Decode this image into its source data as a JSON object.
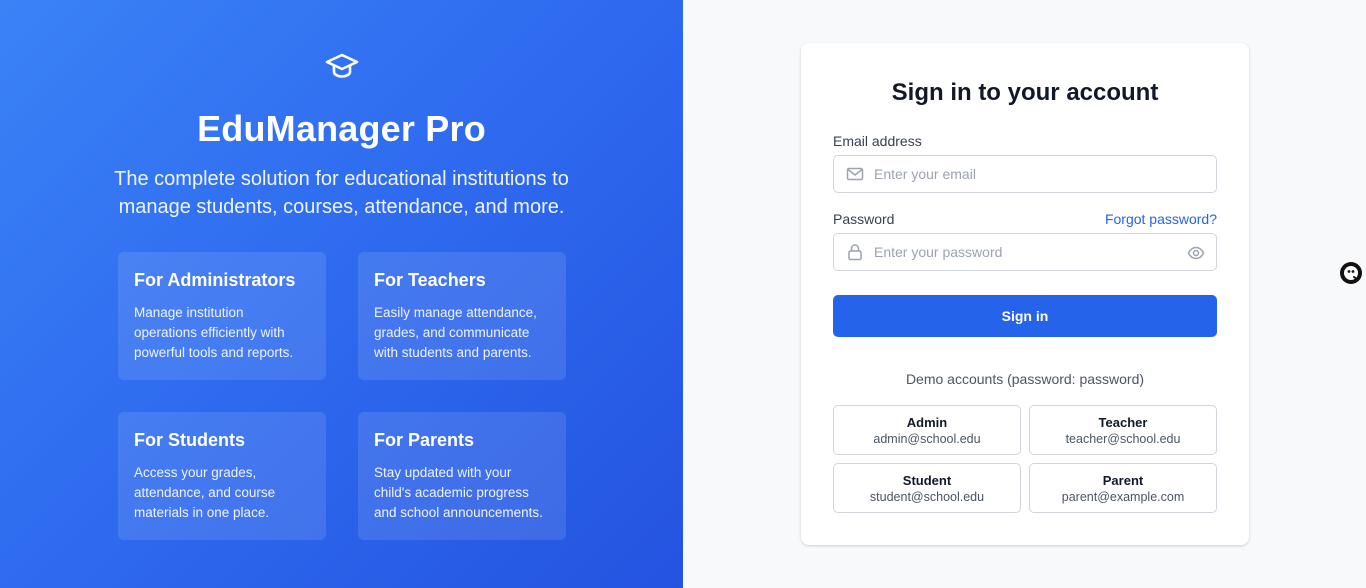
{
  "hero": {
    "title": "EduManager Pro",
    "subtitle": "The complete solution for educational institutions to manage students, courses, attendance, and more.",
    "icon": "graduation-cap-icon",
    "features": [
      {
        "title": "For Administrators",
        "text": "Manage institution operations efficiently with powerful tools and reports."
      },
      {
        "title": "For Teachers",
        "text": "Easily manage attendance, grades, and communicate with students and parents."
      },
      {
        "title": "For Students",
        "text": "Access your grades, attendance, and course materials in one place."
      },
      {
        "title": "For Parents",
        "text": "Stay updated with your child's academic progress and school announcements."
      }
    ]
  },
  "login": {
    "title": "Sign in to your account",
    "email_label": "Email address",
    "email_placeholder": "Enter your email",
    "email_value": "",
    "password_label": "Password",
    "forgot_label": "Forgot password?",
    "password_placeholder": "Enter your password",
    "password_value": "",
    "submit_label": "Sign in",
    "demo_title": "Demo accounts (password: password)",
    "demo_accounts": [
      {
        "role": "Admin",
        "email": "admin@school.edu"
      },
      {
        "role": "Teacher",
        "email": "teacher@school.edu"
      },
      {
        "role": "Student",
        "email": "student@school.edu"
      },
      {
        "role": "Parent",
        "email": "parent@example.com"
      }
    ]
  },
  "colors": {
    "brand": "#2563eb",
    "hero_start": "#3b82f6",
    "hero_end": "#2453e0",
    "right_bg": "#f8f9fb"
  }
}
